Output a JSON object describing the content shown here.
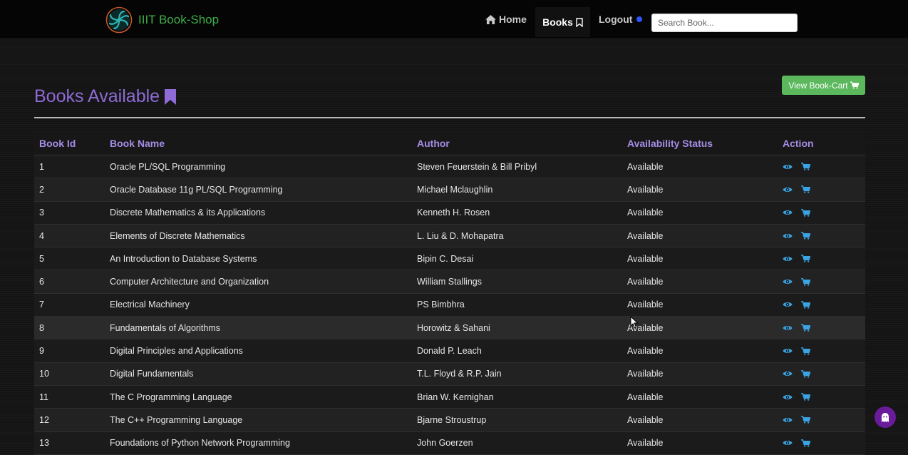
{
  "brand": {
    "name": "IIIT Book-Shop"
  },
  "nav": {
    "home": "Home",
    "books": "Books",
    "logout": "Logout"
  },
  "search": {
    "placeholder": "Search Book..."
  },
  "main": {
    "title": "Books Available",
    "cart_button": "View Book-Cart"
  },
  "table": {
    "headers": {
      "id": "Book Id",
      "name": "Book Name",
      "author": "Author",
      "status": "Availability Status",
      "action": "Action"
    },
    "rows": [
      {
        "id": "1",
        "name": "Oracle PL/SQL Programming",
        "author": "Steven Feuerstein & Bill Pribyl",
        "status": "Available"
      },
      {
        "id": "2",
        "name": "Oracle Database 11g PL/SQL Programming",
        "author": "Michael Mclaughlin",
        "status": "Available"
      },
      {
        "id": "3",
        "name": "Discrete Mathematics & its Applications",
        "author": "Kenneth H. Rosen",
        "status": "Available"
      },
      {
        "id": "4",
        "name": "Elements of Discrete Mathematics",
        "author": "L. Liu & D. Mohapatra",
        "status": "Available"
      },
      {
        "id": "5",
        "name": "An Introduction to Database Systems",
        "author": "Bipin C. Desai",
        "status": "Available"
      },
      {
        "id": "6",
        "name": "Computer Architecture and Organization",
        "author": "William Stallings",
        "status": "Available"
      },
      {
        "id": "7",
        "name": "Electrical Machinery",
        "author": "PS Bimbhra",
        "status": "Available"
      },
      {
        "id": "8",
        "name": "Fundamentals of Algorithms",
        "author": "Horowitz & Sahani",
        "status": "Available"
      },
      {
        "id": "9",
        "name": "Digital Principles and Applications",
        "author": "Donald P. Leach",
        "status": "Available"
      },
      {
        "id": "10",
        "name": "Digital Fundamentals",
        "author": "T.L. Floyd & R.P. Jain",
        "status": "Available"
      },
      {
        "id": "11",
        "name": "The C Programming Language",
        "author": "Brian W. Kernighan",
        "status": "Available"
      },
      {
        "id": "12",
        "name": "The C++ Programming Language",
        "author": "Bjarne Stroustrup",
        "status": "Available"
      },
      {
        "id": "13",
        "name": "Foundations of Python Network Programming",
        "author": "John Goerzen",
        "status": "Available"
      }
    ]
  },
  "colors": {
    "accent": "#8e6bd6",
    "brand": "#3fae49",
    "button": "#5cb85c",
    "action_icon": "#3aa3e3"
  },
  "icons": {
    "home": "home-icon",
    "books": "bookmark-icon",
    "title": "bookmark-icon",
    "cart": "cart-icon",
    "view": "eye-icon",
    "add": "cart-icon"
  }
}
